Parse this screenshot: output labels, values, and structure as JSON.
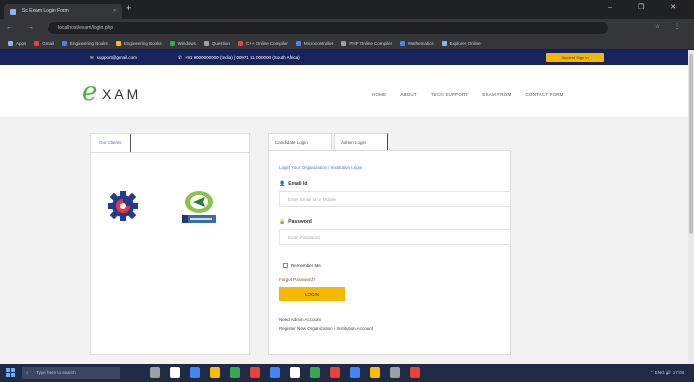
{
  "browser": {
    "tab_title": "Sc Exam Login Form",
    "tab_close": "×",
    "new_tab": "+",
    "window_controls": "–  ❐  ✕",
    "nav": "←  →  ⟳",
    "url": "localhost/exam/login.php",
    "addr_icons": "☆  ⋮",
    "bookmarks": [
      {
        "label": "Apps",
        "color": "#8ab4f8"
      },
      {
        "label": "Gmail",
        "color": "#ea4335"
      },
      {
        "label": "Engineering Books",
        "color": "#4285f4"
      },
      {
        "label": "Engineering Books",
        "color": "#fbbc04"
      },
      {
        "label": "Windows",
        "color": "#34a853"
      },
      {
        "label": "Question",
        "color": "#9aa0a6"
      },
      {
        "label": "C++ Online Compiler",
        "color": "#ea4335"
      },
      {
        "label": "Microcontroller",
        "color": "#4285f4"
      },
      {
        "label": "PHP Online Compiler",
        "color": "#9aa0a6"
      },
      {
        "label": "Mathematics",
        "color": "#4285f4"
      },
      {
        "label": "Explorer Online",
        "color": "#8ab4f8"
      }
    ]
  },
  "site": {
    "email": "support@gmail.com",
    "phone": "+91 9000000000 (India) | 00971 11 000000 (South Africa)",
    "signin_label": "Student Sign In",
    "logo_e": "e",
    "logo_text": "XAM",
    "menu": [
      "HOME",
      "ABOUT",
      "TECH SUPPORT",
      "EXAM FROM",
      "CONTACT FORM"
    ]
  },
  "left_panel": {
    "tab_label": "Our Clients"
  },
  "login": {
    "tab_candidate": "Candidate Login",
    "tab_admin": "Admin Login",
    "intro": "Login Your Organization / Institution Login",
    "email_label": "Email Id",
    "email_placeholder": "Enter Email Id or Mobile",
    "password_label": "Password",
    "password_placeholder": "Enter Password",
    "remember_label": "Remember Me",
    "forgot_label": "Forgot Password?",
    "login_button": "LOGIN",
    "link_admin": "Need Admin Account",
    "link_register": "Register New Organization / Institution Account"
  },
  "taskbar": {
    "search_placeholder": "Type here to search",
    "tray": "⌃  ENG  🔊  17:08",
    "apps": [
      "#9aa0a6",
      "#ffffff",
      "#4285f4",
      "#fbbc04",
      "#34a853",
      "#ea4335",
      "#4285f4",
      "#ffffff",
      "#34a853",
      "#ea4335",
      "#4285f4",
      "#fbbc04",
      "#9aa0a6",
      "#ea4335"
    ]
  },
  "colors": {
    "navy": "#16235c",
    "accent_yellow": "#f5b800",
    "logo_green": "#4caf3a"
  }
}
